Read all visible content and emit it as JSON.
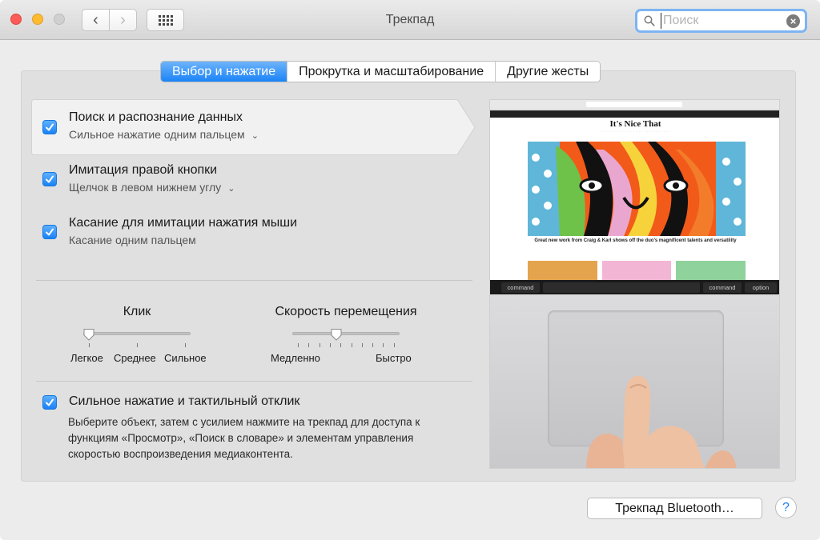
{
  "window": {
    "title": "Трекпад"
  },
  "search": {
    "placeholder": "Поиск",
    "value": ""
  },
  "tabs": [
    {
      "label": "Выбор и нажатие",
      "active": true
    },
    {
      "label": "Прокрутка и масштабирование",
      "active": false
    },
    {
      "label": "Другие жесты",
      "active": false
    }
  ],
  "options": [
    {
      "title": "Поиск и распознание данных",
      "subtitle": "Сильное нажатие одним пальцем",
      "checked": true,
      "has_dropdown": true,
      "selected": true
    },
    {
      "title": "Имитация правой кнопки",
      "subtitle": "Щелчок в левом нижнем углу",
      "checked": true,
      "has_dropdown": true,
      "selected": false
    },
    {
      "title": "Касание для имитации нажатия мыши",
      "subtitle": "Касание одним пальцем",
      "checked": true,
      "has_dropdown": false,
      "selected": false
    }
  ],
  "sliders": {
    "click": {
      "title": "Клик",
      "labels": [
        "Легкое",
        "Среднее",
        "Сильное"
      ],
      "value_index": 0,
      "positions": 3
    },
    "speed": {
      "title": "Скорость перемещения",
      "min_label": "Медленно",
      "max_label": "Быстро",
      "value": 0.4
    }
  },
  "force_touch": {
    "title": "Сильное нажатие и тактильный отклик",
    "checked": true,
    "description": "Выберите объект, затем с усилием нажмите на трекпад для доступа к функциям «Просмотр», «Поиск в словаре» и элементам управления скоростью воспроизведения медиаконтента."
  },
  "preview": {
    "site_name": "It's Nice That",
    "headline": "Great new work from Craig & Karl shows off the duo's magnificent talents and versatility",
    "keys": [
      "command",
      "command",
      "option"
    ]
  },
  "footer": {
    "bluetooth_button": "Трекпад Bluetooth…",
    "help": "?"
  },
  "colors": {
    "accent": "#1b84f7",
    "search_focus": "#7db4f3",
    "close": "#fc5b57",
    "minimize": "#fdbb2e"
  }
}
